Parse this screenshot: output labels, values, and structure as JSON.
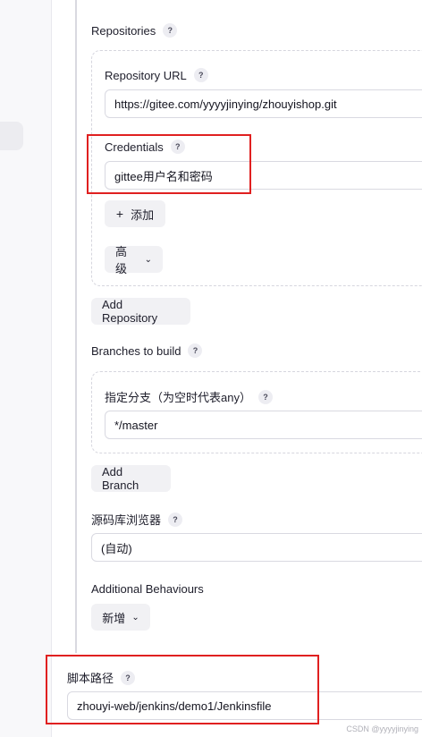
{
  "scm": {
    "repositories_label": "Repositories",
    "repository_url_label": "Repository URL",
    "repository_url_value": "https://gitee.com/yyyyjinying/zhouyishop.git",
    "credentials_label": "Credentials",
    "credentials_value": "gittee用户名和密码",
    "add_button": "添加",
    "advanced_button": "高级",
    "add_repository_button": "Add Repository",
    "branches_label": "Branches to build",
    "branch_specifier_label": "指定分支（为空时代表any）",
    "branch_value": "*/master",
    "add_branch_button": "Add Branch",
    "browser_label": "源码库浏览器",
    "browser_value": "(自动)",
    "behaviours_label": "Additional Behaviours",
    "behaviours_button": "新增"
  },
  "pipeline": {
    "script_path_label": "脚本路径",
    "script_path_value": "zhouyi-web/jenkins/demo1/Jenkinsfile"
  },
  "help_glyph": "?",
  "plus_glyph": "+",
  "chevron_glyph": "⌄",
  "watermark": "CSDN @yyyyjinying",
  "colors": {
    "highlight": "#e02020",
    "field_border": "#d9d9e1",
    "button_bg": "#f1f1f4"
  }
}
